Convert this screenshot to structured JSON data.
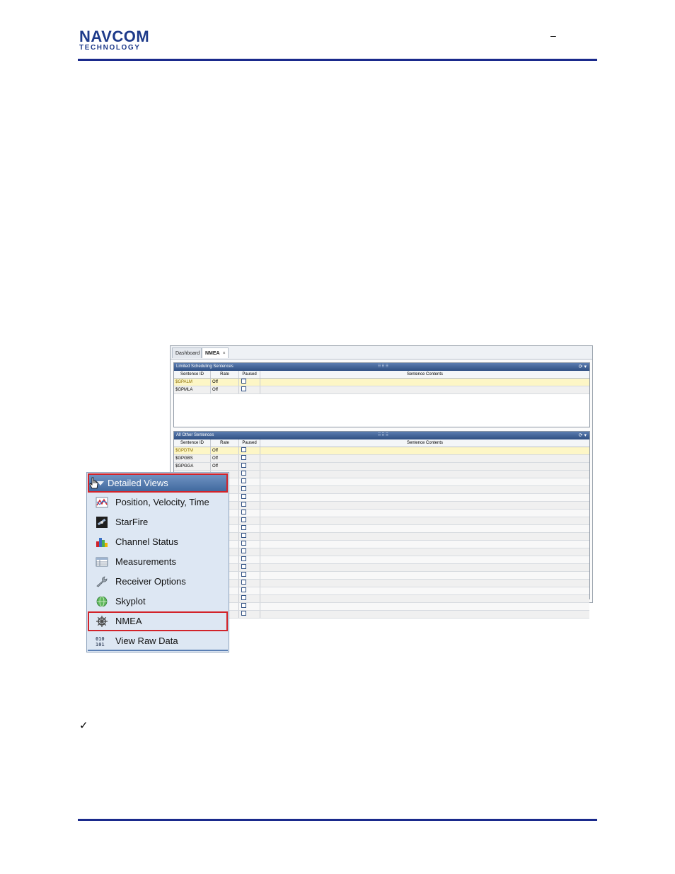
{
  "header": {
    "logo_top": "NAVCOM",
    "logo_bottom": "TECHNOLOGY",
    "dash": "–"
  },
  "window": {
    "tabs": [
      {
        "label": "Dashboard"
      },
      {
        "label": "NMEA",
        "close": "×"
      }
    ],
    "limited_panel": {
      "title": "Limited Scheduling Sentences",
      "columns": [
        "Sentence ID",
        "Rate",
        "Paused",
        "Sentence Contents"
      ],
      "rows": [
        {
          "id": "$GPALM",
          "rate": "Off"
        },
        {
          "id": "$GPMLA",
          "rate": "Off"
        }
      ]
    },
    "other_panel": {
      "title": "All Other Sentences",
      "columns": [
        "Sentence ID",
        "Rate",
        "Paused",
        "Sentence Contents"
      ],
      "rows": [
        {
          "id": "$GPDTM",
          "rate": "Off"
        },
        {
          "id": "$GPGBS",
          "rate": "Off"
        },
        {
          "id": "$GPGGA",
          "rate": "Off"
        }
      ]
    }
  },
  "menu": {
    "header": "Detailed Views",
    "items": [
      {
        "label": "Position, Velocity, Time",
        "icon": "pvt-chart-icon"
      },
      {
        "label": "StarFire",
        "icon": "starfire-satellite-icon"
      },
      {
        "label": "Channel Status",
        "icon": "bar-chart-icon"
      },
      {
        "label": "Measurements",
        "icon": "table-icon"
      },
      {
        "label": "Receiver Options",
        "icon": "wrench-icon"
      },
      {
        "label": "Skyplot",
        "icon": "globe-icon"
      },
      {
        "label": "NMEA",
        "icon": "ship-wheel-icon"
      },
      {
        "label": "View Raw Data",
        "icon": "binary-icon"
      }
    ],
    "highlight_color": "#d2232a"
  },
  "checkmark": "✓"
}
